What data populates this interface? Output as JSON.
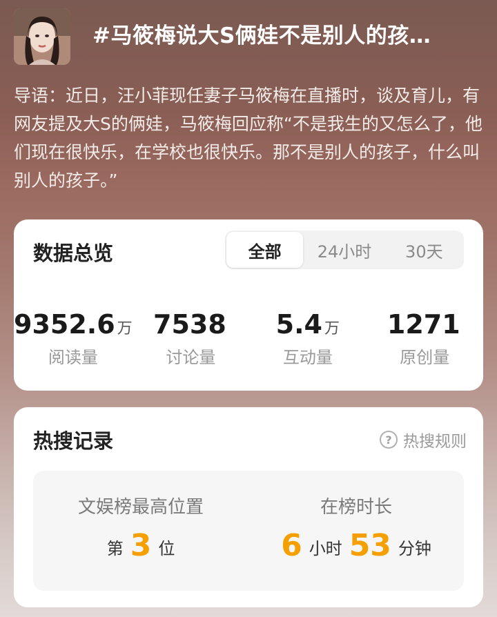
{
  "header": {
    "topic_title": "#马筱梅说大S俩娃不是别人的孩…"
  },
  "intro": "导语：近日，汪小菲现任妻子马筱梅在直播时，谈及育儿，有网友提及大S的俩娃，马筱梅回应称“不是我生的又怎么了，他们现在很快乐，在学校也很快乐。那不是别人的孩子，什么叫别人的孩子。”",
  "overview": {
    "title": "数据总览",
    "tabs": [
      {
        "label": "全部",
        "active": true
      },
      {
        "label": "24小时",
        "active": false
      },
      {
        "label": "30天",
        "active": false
      }
    ],
    "stats": [
      {
        "value": "9352.6",
        "unit": "万",
        "label": "阅读量"
      },
      {
        "value": "7538",
        "unit": "",
        "label": "讨论量"
      },
      {
        "value": "5.4",
        "unit": "万",
        "label": "互动量"
      },
      {
        "value": "1271",
        "unit": "",
        "label": "原创量"
      }
    ]
  },
  "hot": {
    "title": "热搜记录",
    "rules_label": "热搜规则",
    "rules_icon": "help-circle-icon",
    "rank": {
      "label": "文娱榜最高位置",
      "prefix": "第",
      "value": "3",
      "suffix": "位"
    },
    "duration": {
      "label": "在榜时长",
      "hours": "6",
      "hours_unit": "小时",
      "minutes": "53",
      "minutes_unit": "分钟"
    }
  },
  "colors": {
    "accent": "#f5a000",
    "title": "#ffffff"
  }
}
